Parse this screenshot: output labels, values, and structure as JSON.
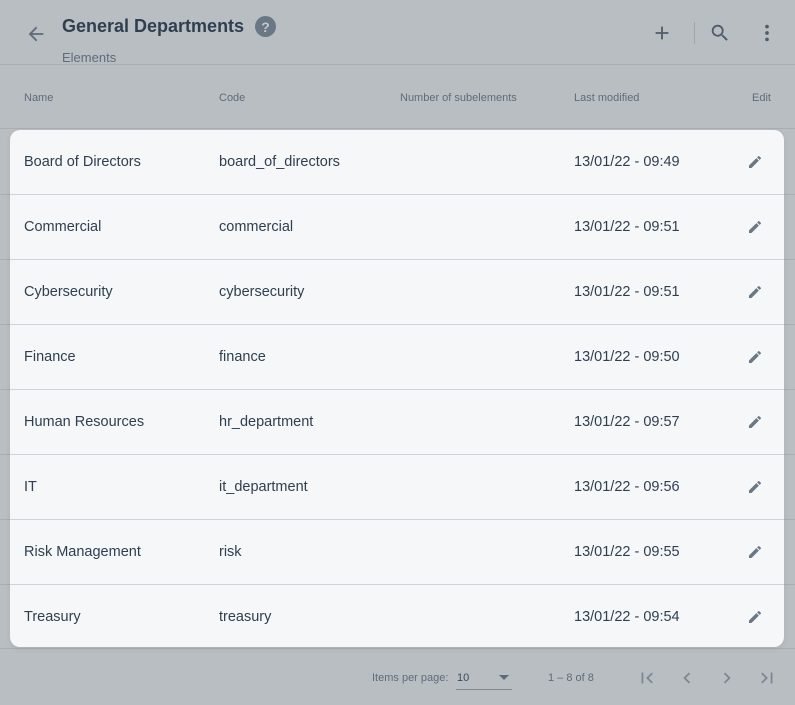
{
  "header": {
    "title": "General Departments",
    "help": "?",
    "subtitle": "Elements"
  },
  "icons": {
    "back": "arrow-left-icon",
    "add": "plus-icon",
    "search": "search-icon",
    "more": "more-vertical-icon",
    "edit": "pencil-icon"
  },
  "columns": {
    "name": "Name",
    "code": "Code",
    "subelements": "Number of subelements",
    "modified": "Last modified",
    "edit": "Edit"
  },
  "rows": [
    {
      "name": "Board of Directors",
      "code": "board_of_directors",
      "modified": "13/01/22 - 09:49"
    },
    {
      "name": "Commercial",
      "code": "commercial",
      "modified": "13/01/22 - 09:51"
    },
    {
      "name": "Cybersecurity",
      "code": "cybersecurity",
      "modified": "13/01/22 - 09:51"
    },
    {
      "name": "Finance",
      "code": "finance",
      "modified": "13/01/22 - 09:50"
    },
    {
      "name": "Human Resources",
      "code": "hr_department",
      "modified": "13/01/22 - 09:57"
    },
    {
      "name": "IT",
      "code": "it_department",
      "modified": "13/01/22 - 09:56"
    },
    {
      "name": "Risk Management",
      "code": "risk",
      "modified": "13/01/22 - 09:55"
    },
    {
      "name": "Treasury",
      "code": "treasury",
      "modified": "13/01/22 - 09:54"
    }
  ],
  "paginator": {
    "items_per_page_label": "Items per page:",
    "items_per_page": "10",
    "range": "1 – 8 of 8"
  },
  "colors": {
    "overlay_background": "#b9bec3",
    "card_background": "#f5f7f9",
    "text_primary": "#2f3f50",
    "icon_color": "#6a7785"
  }
}
